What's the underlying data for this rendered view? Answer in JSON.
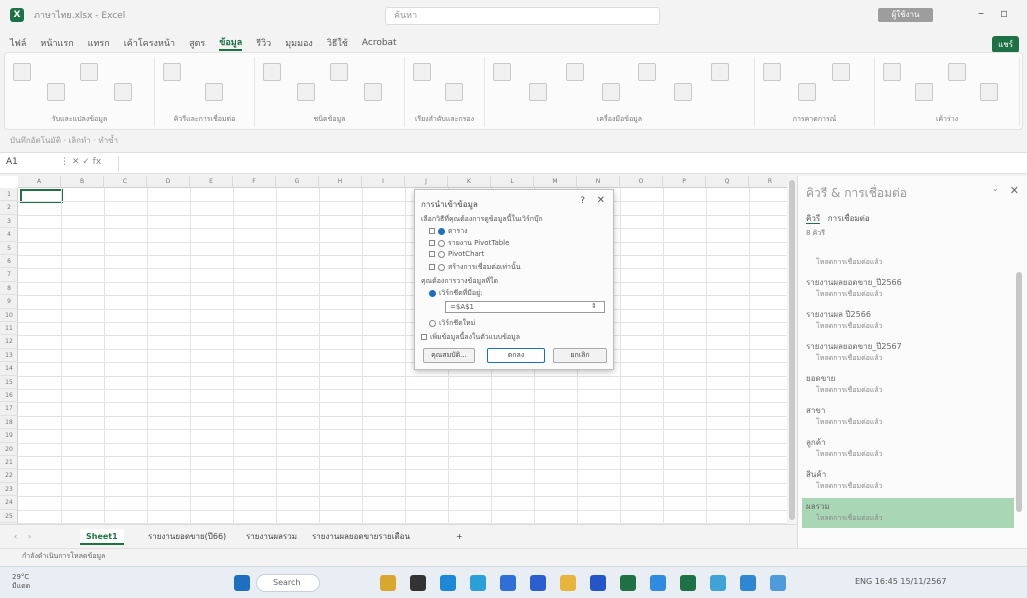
{
  "title_bar": {
    "title": "ภาษาไทย.xlsx - Excel",
    "search_placeholder": "ค้นหา",
    "account": "ผู้ใช้งาน",
    "minimize": "–",
    "restore": "▫"
  },
  "menu": {
    "tabs": [
      "ไฟล์",
      "หน้าแรก",
      "แทรก",
      "เค้าโครงหน้า",
      "สูตร",
      "ข้อมูล",
      "รีวิว",
      "มุมมอง",
      "วิธีใช้",
      "Acrobat"
    ],
    "active_index": 5,
    "share": "แชร์"
  },
  "ribbon": {
    "groups": [
      {
        "label": "รับและแปลงข้อมูล"
      },
      {
        "label": "คิวรีและการเชื่อมต่อ"
      },
      {
        "label": "ชนิดข้อมูล"
      },
      {
        "label": "เรียงลำดับและกรอง"
      },
      {
        "label": "เครื่องมือข้อมูล"
      },
      {
        "label": "การคาดการณ์"
      },
      {
        "label": "เค้าร่าง"
      }
    ]
  },
  "quick_access": "บันทึกอัตโนมัติ  ·  เลิกทำ  ·  ทำซ้ำ",
  "formula_bar": {
    "name_box": "A1",
    "fx": "⋮  ✕  ✓  fx"
  },
  "grid": {
    "columns": [
      "A",
      "B",
      "C",
      "D",
      "E",
      "F",
      "G",
      "H",
      "I",
      "J",
      "K",
      "L",
      "M",
      "N",
      "O",
      "P",
      "Q",
      "R"
    ],
    "rows": [
      "1",
      "2",
      "3",
      "4",
      "5",
      "6",
      "7",
      "8",
      "9",
      "10",
      "11",
      "12",
      "13",
      "14",
      "15",
      "16",
      "17",
      "18",
      "19",
      "20",
      "21",
      "22",
      "23",
      "24",
      "25"
    ]
  },
  "dialog": {
    "title": "การนำเข้าข้อมูล",
    "help": "?",
    "close": "✕",
    "prompt": "เลือกวิธีที่คุณต้องการดูข้อมูลนี้ในเวิร์กบุ๊ก",
    "view_options": [
      {
        "label": "ตาราง",
        "checked": true
      },
      {
        "label": "รายงาน PivotTable",
        "checked": false
      },
      {
        "label": "PivotChart",
        "checked": false
      },
      {
        "label": "สร้างการเชื่อมต่อเท่านั้น",
        "checked": false
      }
    ],
    "where_prompt": "คุณต้องการวางข้อมูลที่ใด",
    "where_options": [
      {
        "label": "เวิร์กชีตที่มีอยู่:",
        "checked": true
      },
      {
        "label": "เวิร์กชีตใหม่",
        "checked": false
      }
    ],
    "range_value": "=$A$1",
    "add_to_model": "เพิ่มข้อมูลนี้ลงในตัวแบบข้อมูล",
    "properties_button": "คุณสมบัติ...",
    "ok_button": "ตกลง",
    "cancel_button": "ยกเลิก"
  },
  "side_pane": {
    "title": "คิวรี & การเชื่อมต่อ",
    "tab_queries": "คิวรี",
    "tab_connections": "การเชื่อมต่อ",
    "count": "8 คิวรี",
    "items": [
      {
        "name": "",
        "sub": "โหลดการเชื่อมต่อแล้ว"
      },
      {
        "name": "รายงานผลยอดขาย_ปี2566",
        "sub": "โหลดการเชื่อมต่อแล้ว"
      },
      {
        "name": "รายงานผล ปี2566",
        "sub": "โหลดการเชื่อมต่อแล้ว"
      },
      {
        "name": "รายงานผลยอดขาย_ปี2567",
        "sub": "โหลดการเชื่อมต่อแล้ว"
      },
      {
        "name": "ยอดขาย",
        "sub": "โหลดการเชื่อมต่อแล้ว"
      },
      {
        "name": "สาขา",
        "sub": "โหลดการเชื่อมต่อแล้ว"
      },
      {
        "name": "ลูกค้า",
        "sub": "โหลดการเชื่อมต่อแล้ว"
      },
      {
        "name": "สินค้า",
        "sub": "โหลดการเชื่อมต่อแล้ว"
      },
      {
        "name": "ผลรวม",
        "sub": "โหลดการเชื่อมต่อแล้ว"
      }
    ],
    "selected_index": 8
  },
  "sheets": {
    "tabs": [
      "Sheet1",
      "รายงานยอดขาย(ปี66)",
      "รายงานผลรวม",
      "รายงานผลยอดขายรายเดือน"
    ],
    "active_index": 0,
    "add": "+"
  },
  "status_bar": {
    "text": "กำลังดำเนินการโหลดข้อมูล"
  },
  "taskbar": {
    "weather": "29°C",
    "weather_sub": "มีแดด",
    "search": "Search",
    "tray_text": "ENG  16:45  15/11/2567"
  }
}
